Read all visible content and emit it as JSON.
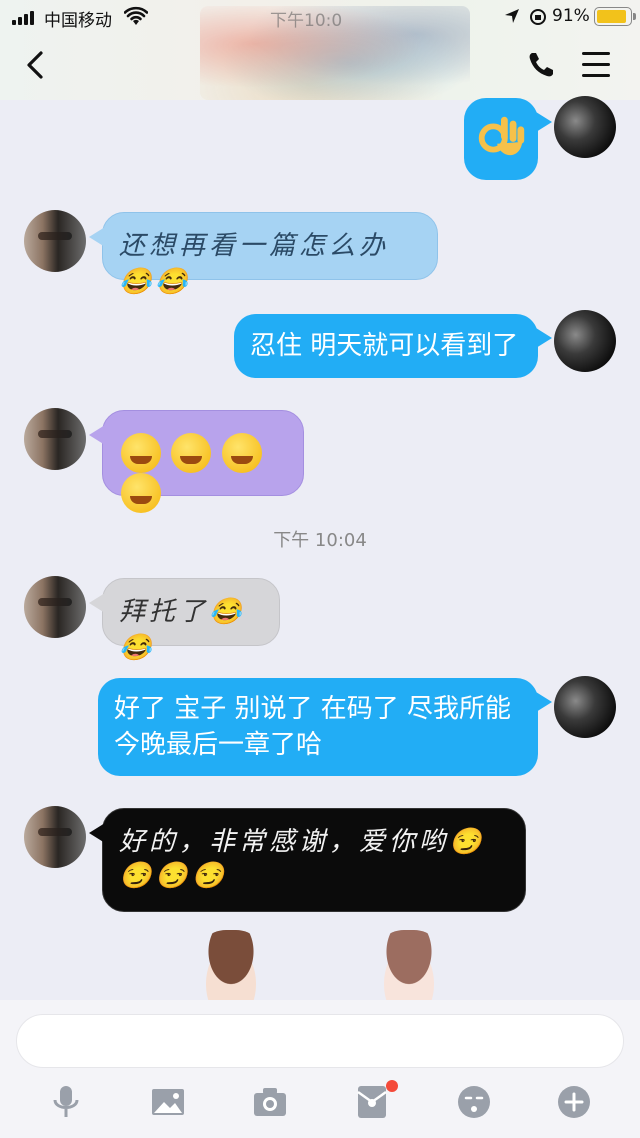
{
  "status_bar": {
    "carrier": "中国移动",
    "time": "下午10:0",
    "battery": "91%"
  },
  "chat": {
    "messages": [
      {
        "side": "right",
        "kind": "sticker",
        "emoji": "👌"
      },
      {
        "side": "left",
        "text": "还想再看一篇怎么办😂😂"
      },
      {
        "side": "right",
        "text": "忍住 明天就可以看到了"
      },
      {
        "side": "left",
        "text": "🥺🥺🥺🥺"
      },
      {
        "side": "left",
        "text": "拜托了😂😂"
      },
      {
        "side": "right",
        "text": "好了 宝子 别说了 在码了 尽我所能今晚最后一章了哈"
      },
      {
        "side": "left",
        "text": "好的，非常感谢，爱你哟😏😏😏😏"
      }
    ],
    "timestamp": "下午 10:04"
  },
  "input": {
    "placeholder": ""
  },
  "toolbar": {
    "icons": [
      "microphone-icon",
      "image-icon",
      "camera-icon",
      "red-packet-icon",
      "emoji-icon",
      "plus-icon"
    ]
  }
}
